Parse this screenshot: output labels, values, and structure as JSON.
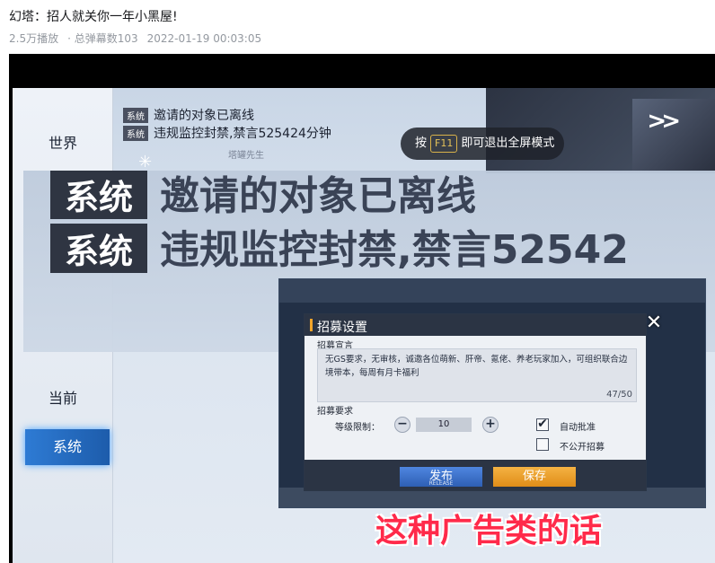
{
  "page": {
    "title": "幻塔：招人就关你一年小黑屋!",
    "plays": "2.5万播放",
    "danmaku": "· 总弹幕数103",
    "date": "2022-01-19 00:03:05"
  },
  "game": {
    "tabs": {
      "world": "世界",
      "current": "当前",
      "system": "系统"
    },
    "chat": [
      {
        "tag": "系统",
        "text": "邀请的对象已离线"
      },
      {
        "tag": "系统",
        "text": "违规监控封禁,禁言525424分钟"
      }
    ],
    "ghost_name": "塔罐先生",
    "zoom": [
      {
        "tag": "系统",
        "text": "邀请的对象已离线"
      },
      {
        "tag": "系统",
        "text": "违规监控封禁,禁言52542"
      }
    ],
    "fullscreen_hint": {
      "prefix": "按",
      "key": "F11",
      "suffix": "即可退出全屏模式"
    },
    "dialog": {
      "title": "招募设置",
      "declaration_label": "招募宣言",
      "declaration_text": "无GS要求，无审核，诚邀各位萌新、肝帝、氪佬、养老玩家加入，可组织联合边境带本，每周有月卡福利",
      "char_count": "47/50",
      "requirements_label": "招募要求",
      "level_label": "等级限制：",
      "level_value": "10",
      "minus": "−",
      "plus": "+",
      "auto_approve": "自动批准",
      "auto_approve_checked": "✔",
      "not_public": "不公开招募",
      "release_label": "发布",
      "release_sub": "RELEASE",
      "save_label": "保存",
      "close": "✕"
    },
    "subtitle": "这种广告类的话"
  },
  "colors": {
    "accent_blue": "#2e7bd4",
    "save_orange": "#f4b243",
    "subtitle_red": "#ff2a4a"
  }
}
